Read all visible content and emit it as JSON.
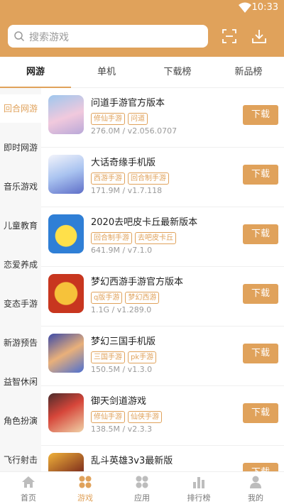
{
  "status_bar": {
    "time": "10:33"
  },
  "search": {
    "placeholder": "搜索游戏"
  },
  "tabs": [
    {
      "label": "网游"
    },
    {
      "label": "单机"
    },
    {
      "label": "下载榜"
    },
    {
      "label": "新品榜"
    }
  ],
  "sidebar": [
    {
      "label": "回合网游"
    },
    {
      "label": "即时网游"
    },
    {
      "label": "音乐游戏"
    },
    {
      "label": "儿童教育"
    },
    {
      "label": "恋爱养成"
    },
    {
      "label": "变态手游"
    },
    {
      "label": "新游预告"
    },
    {
      "label": "益智休闲"
    },
    {
      "label": "角色扮演"
    },
    {
      "label": "飞行射击"
    }
  ],
  "download_label": "下载",
  "games": [
    {
      "title": "问道手游官方版本",
      "tags": [
        "修仙手游",
        "问道"
      ],
      "meta": "276.0M / v2.056.0707"
    },
    {
      "title": "大话奇缘手机版",
      "tags": [
        "西游手游",
        "回合制手游"
      ],
      "meta": "171.9M / v1.7.118"
    },
    {
      "title": "2020去吧皮卡丘最新版本",
      "tags": [
        "回合制手游",
        "去吧皮卡丘"
      ],
      "meta": "641.9M / v7.1.0"
    },
    {
      "title": "梦幻西游手游官方版本",
      "tags": [
        "q版手游",
        "梦幻西游"
      ],
      "meta": "1.1G / v1.289.0"
    },
    {
      "title": "梦幻三国手机版",
      "tags": [
        "三国手游",
        "pk手游"
      ],
      "meta": "150.5M / v1.3.0"
    },
    {
      "title": "御天剑道游戏",
      "tags": [
        "修仙手游",
        "仙侠手游"
      ],
      "meta": "138.5M / v2.3.3"
    },
    {
      "title": "乱斗英雄3v3最新版",
      "tags": [],
      "meta": ""
    }
  ],
  "bottom_nav": [
    {
      "label": "首页"
    },
    {
      "label": "游戏"
    },
    {
      "label": "应用"
    },
    {
      "label": "排行榜"
    },
    {
      "label": "我的"
    }
  ],
  "colors": {
    "accent": "#e0a25b"
  }
}
